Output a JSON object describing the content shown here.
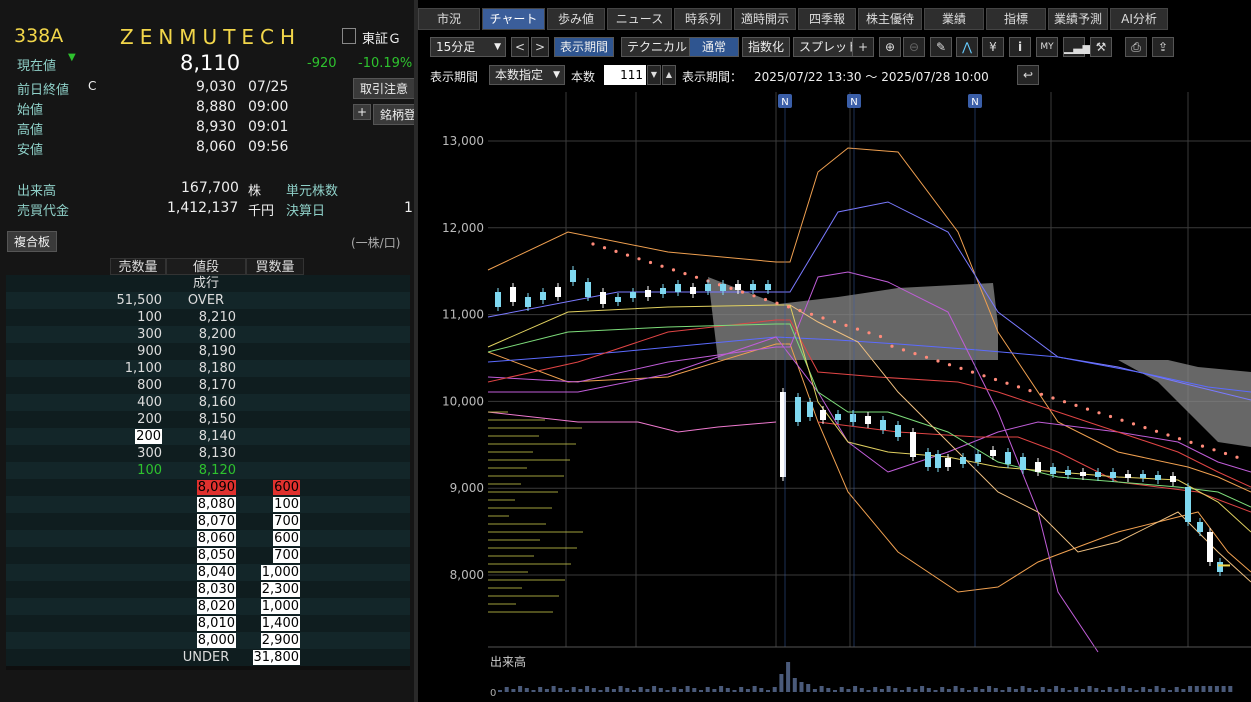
{
  "stock": {
    "code": "338A",
    "name": "ZENMUTECH",
    "market": "東証Ｇ",
    "current_label": "現在値",
    "current_price": "8,110",
    "change": "-920",
    "change_pct": "-10.19%",
    "prev_close_label": "前日終値",
    "prev_close_mark": "C",
    "prev_close": "9,030",
    "prev_close_date": "07/25",
    "open_label": "始値",
    "open": "8,880",
    "open_time": "09:00",
    "high_label": "高値",
    "high": "8,930",
    "high_time": "09:01",
    "low_label": "安値",
    "low": "8,060",
    "low_time": "09:56",
    "volume_label": "出来高",
    "volume": "167,700",
    "volume_unit": "株",
    "turnover_label": "売買代金",
    "turnover": "1,412,137",
    "turnover_unit": "千円",
    "unit_shares_label": "単元株数",
    "settle_label": "決算日",
    "settle_value": "1",
    "notice_button": "取引注意",
    "add_button": "銘柄登"
  },
  "board": {
    "title": "複合板",
    "unit_note": "(一株/口)",
    "headers": {
      "sell": "売数量",
      "price": "値段",
      "buy": "買数量"
    },
    "rows": [
      {
        "sell": "",
        "price": "成行",
        "buy": ""
      },
      {
        "sell": "51,500",
        "price": "OVER",
        "buy": ""
      },
      {
        "sell": "100",
        "price": "8,210",
        "buy": ""
      },
      {
        "sell": "300",
        "price": "8,200",
        "buy": ""
      },
      {
        "sell": "900",
        "price": "8,190",
        "buy": ""
      },
      {
        "sell": "1,100",
        "price": "8,180",
        "buy": ""
      },
      {
        "sell": "800",
        "price": "8,170",
        "buy": ""
      },
      {
        "sell": "400",
        "price": "8,160",
        "buy": ""
      },
      {
        "sell": "200",
        "price": "8,150",
        "buy": ""
      },
      {
        "sell": "200",
        "price": "8,140",
        "buy": ""
      },
      {
        "sell": "300",
        "price": "8,130",
        "buy": ""
      },
      {
        "sell": "100",
        "price": "8,120",
        "buy": ""
      },
      {
        "sell": "",
        "price": "8,090",
        "buy": "600"
      },
      {
        "sell": "",
        "price": "8,080",
        "buy": "100"
      },
      {
        "sell": "",
        "price": "8,070",
        "buy": "700"
      },
      {
        "sell": "",
        "price": "8,060",
        "buy": "600"
      },
      {
        "sell": "",
        "price": "8,050",
        "buy": "700"
      },
      {
        "sell": "",
        "price": "8,040",
        "buy": "1,000"
      },
      {
        "sell": "",
        "price": "8,030",
        "buy": "2,300"
      },
      {
        "sell": "",
        "price": "8,020",
        "buy": "1,000"
      },
      {
        "sell": "",
        "price": "8,010",
        "buy": "1,400"
      },
      {
        "sell": "",
        "price": "8,000",
        "buy": "2,900"
      },
      {
        "sell": "",
        "price": "UNDER",
        "buy": "31,800"
      }
    ]
  },
  "tabs": [
    "市況",
    "チャート",
    "歩み値",
    "ニュース",
    "時系列",
    "適時開示",
    "四季報",
    "株主優待",
    "業績",
    "指標",
    "業績予測",
    "AI分析"
  ],
  "toolbar": {
    "interval": "15分足",
    "period_btn": "表示期間",
    "technical_btn": "テクニカル",
    "normal_btn": "通常",
    "index_btn": "指数化",
    "spread_btn": "スプレッド",
    "yen": "¥",
    "info": "i"
  },
  "period": {
    "label": "表示期間",
    "mode": "本数指定",
    "count_label": "本数",
    "count": "111",
    "range_label": "表示期間：",
    "range": "2025/07/22 13:30 ～ 2025/07/28 10:00"
  },
  "chart": {
    "volume_label": "出来高",
    "volume_zero": "0",
    "news_marker": "N",
    "colors": {
      "up": "#7fd8f0",
      "down": "#ffffff",
      "psar": "#ff8a7a",
      "cloud": "#8a8a8a"
    }
  },
  "chart_data": {
    "type": "line",
    "ylim": [
      7600,
      13200
    ],
    "y_ticks": [
      "13,000",
      "12,000",
      "11,000",
      "10,000",
      "9,000",
      "8,000"
    ],
    "last_price": 8110
  }
}
